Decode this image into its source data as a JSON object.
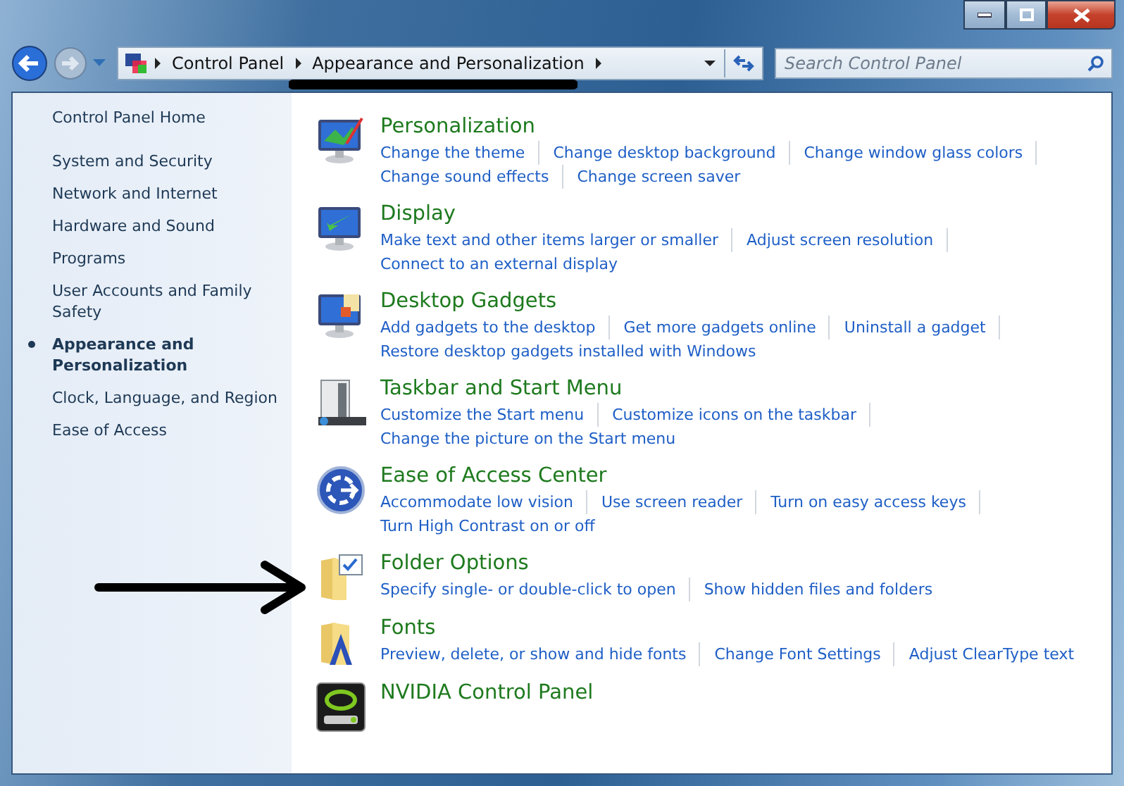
{
  "address_bar": {
    "breadcrumbs": [
      "Control Panel",
      "Appearance and Personalization"
    ]
  },
  "search": {
    "placeholder": "Search Control Panel"
  },
  "sidebar": {
    "home": "Control Panel Home",
    "items": [
      {
        "label": "System and Security",
        "selected": false
      },
      {
        "label": "Network and Internet",
        "selected": false
      },
      {
        "label": "Hardware and Sound",
        "selected": false
      },
      {
        "label": "Programs",
        "selected": false
      },
      {
        "label": "User Accounts and Family Safety",
        "selected": false
      },
      {
        "label": "Appearance and Personalization",
        "selected": true
      },
      {
        "label": "Clock, Language, and Region",
        "selected": false
      },
      {
        "label": "Ease of Access",
        "selected": false
      }
    ]
  },
  "categories": [
    {
      "kind": "personalization",
      "title": "Personalization",
      "lines": [
        [
          "Change the theme",
          "Change desktop background",
          "Change window glass colors"
        ],
        [
          "Change sound effects",
          "Change screen saver"
        ]
      ]
    },
    {
      "kind": "display",
      "title": "Display",
      "lines": [
        [
          "Make text and other items larger or smaller",
          "Adjust screen resolution"
        ],
        [
          "Connect to an external display"
        ]
      ]
    },
    {
      "kind": "gadgets",
      "title": "Desktop Gadgets",
      "lines": [
        [
          "Add gadgets to the desktop",
          "Get more gadgets online",
          "Uninstall a gadget"
        ],
        [
          "Restore desktop gadgets installed with Windows"
        ]
      ]
    },
    {
      "kind": "taskbar",
      "title": "Taskbar and Start Menu",
      "lines": [
        [
          "Customize the Start menu",
          "Customize icons on the taskbar"
        ],
        [
          "Change the picture on the Start menu"
        ]
      ]
    },
    {
      "kind": "ease",
      "title": "Ease of Access Center",
      "lines": [
        [
          "Accommodate low vision",
          "Use screen reader",
          "Turn on easy access keys"
        ],
        [
          "Turn High Contrast on or off"
        ]
      ]
    },
    {
      "kind": "folder",
      "title": "Folder Options",
      "lines": [
        [
          "Specify single- or double-click to open",
          "Show hidden files and folders"
        ]
      ]
    },
    {
      "kind": "fonts",
      "title": "Fonts",
      "lines": [
        [
          "Preview, delete, or show and hide fonts",
          "Change Font Settings",
          "Adjust ClearType text"
        ]
      ]
    },
    {
      "kind": "nvidia",
      "title": "NVIDIA Control Panel"
    }
  ]
}
